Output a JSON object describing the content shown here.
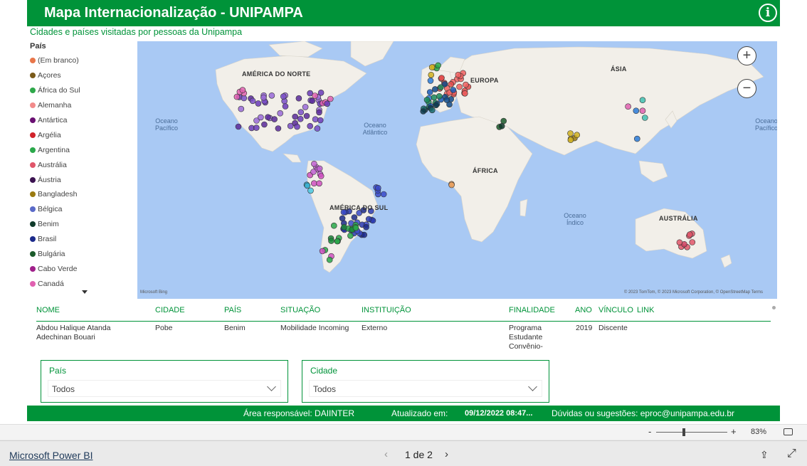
{
  "header": {
    "title": "Mapa Internacionalização - UNIPAMPA",
    "info_icon": "i"
  },
  "map": {
    "subtitle": "Cidades e países visitadas por pessoas da Unipampa",
    "legend_title": "País",
    "legend": [
      {
        "label": "(Em branco)",
        "color": "#e8764a"
      },
      {
        "label": "Açores",
        "color": "#7a5a1a"
      },
      {
        "label": "África do Sul",
        "color": "#2ea84a"
      },
      {
        "label": "Alemanha",
        "color": "#f28b8b"
      },
      {
        "label": "Antártica",
        "color": "#6a0f72"
      },
      {
        "label": "Argélia",
        "color": "#d1232a"
      },
      {
        "label": "Argentina",
        "color": "#2aa84a"
      },
      {
        "label": "Austrália",
        "color": "#e0566a"
      },
      {
        "label": "Áustria",
        "color": "#3b1250"
      },
      {
        "label": "Bangladesh",
        "color": "#9a7a10"
      },
      {
        "label": "Bélgica",
        "color": "#5a6ac8"
      },
      {
        "label": "Benim",
        "color": "#0f3a2a"
      },
      {
        "label": "Brasil",
        "color": "#1c2a8a"
      },
      {
        "label": "Bulgária",
        "color": "#1a5a2a"
      },
      {
        "label": "Cabo Verde",
        "color": "#a0208a"
      },
      {
        "label": "Canadá",
        "color": "#e060b0"
      }
    ],
    "continents": [
      "AMÉRICA DO NORTE",
      "EUROPA",
      "ÁSIA",
      "ÁFRICA",
      "AMÉRICA DO SUL",
      "AUSTRÁLIA"
    ],
    "oceans": [
      "Oceano Pacífico",
      "Oceano Atlântico",
      "Oceano Índico",
      "Oceano Pacífico"
    ],
    "zoom_in": "+",
    "zoom_out": "−",
    "attribution": "Microsoft Bing",
    "copyright": "© 2023 TomTom, © 2023 Microsoft Corporation, © OpenStreetMap  Terms"
  },
  "table": {
    "headers": [
      "NOME",
      "CIDADE",
      "PAÍS",
      "SITUAÇÃO",
      "INSTITUIÇÃO",
      "FINALIDADE",
      "ANO",
      "VÍNCULO",
      "LINK"
    ],
    "rows": [
      {
        "nome": "Abdou Halique Atanda Adechinan Bouari",
        "cidade": "Pobe",
        "pais": "Benim",
        "situacao": "Mobilidade Incoming",
        "instituicao": "Externo",
        "finalidade": "Programa Estudante Convênio-",
        "ano": "2019",
        "vinculo": "Discente",
        "link": ""
      }
    ]
  },
  "slicers": {
    "pais": {
      "title": "País",
      "value": "Todos"
    },
    "cidade": {
      "title": "Cidade",
      "value": "Todos"
    }
  },
  "footer": {
    "area": "Área responsável: DAIINTER",
    "updated_label": "Atualizado em:",
    "updated_value": "09/12/2022 08:47...",
    "contact": "Dúvidas ou sugestões: eproc@unipampa.edu.br"
  },
  "zoombar": {
    "minus": "-",
    "plus": "+",
    "zoom": "83%"
  },
  "bottombar": {
    "brand": "Microsoft Power BI",
    "prev": "‹",
    "page": "1 de 2",
    "next": "›"
  }
}
